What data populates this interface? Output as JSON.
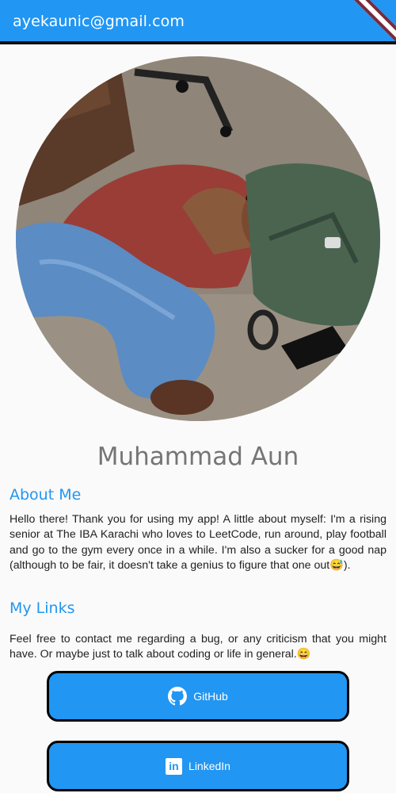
{
  "appbar": {
    "title": "ayekaunic@gmail.com"
  },
  "profile": {
    "name": "Muhammad Aun"
  },
  "about": {
    "title": "About Me",
    "text": "Hello there! Thank you for using my app! A little about myself: I'm a rising senior at The IBA Karachi who loves to LeetCode, run around, play football and go to the gym every once in a while. I'm also a sucker for a good nap (although to be fair, it doesn't take a genius to figure that one out😅)."
  },
  "links": {
    "title": "My Links",
    "text": "Feel free to contact me regarding a bug, or any criticism that you might have. Or maybe just to talk about coding or life in general.😄",
    "github_label": "GitHub",
    "linkedin_label": "LinkedIn",
    "linkedin_glyph": "in"
  },
  "colors": {
    "primary": "#2196f3",
    "name_gray": "#757575"
  },
  "icons": [
    "github-icon",
    "linkedin-icon"
  ]
}
